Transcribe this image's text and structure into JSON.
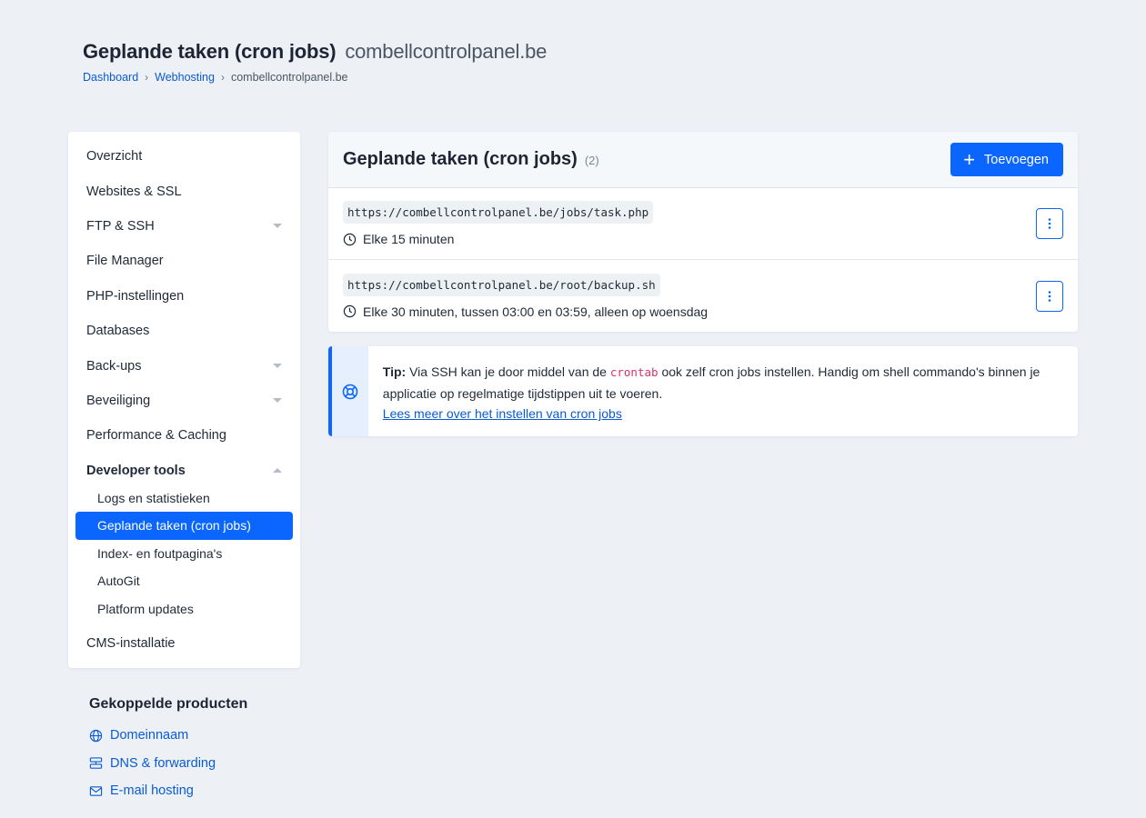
{
  "header": {
    "title": "Geplande taken (cron jobs)",
    "domain": "combellcontrolpanel.be",
    "breadcrumb": [
      "Dashboard",
      "Webhosting",
      "combellcontrolpanel.be"
    ]
  },
  "sidebar": {
    "items": [
      {
        "label": "Overzicht"
      },
      {
        "label": "Websites & SSL"
      },
      {
        "label": "FTP & SSH"
      },
      {
        "label": "File Manager"
      },
      {
        "label": "PHP-instellingen"
      },
      {
        "label": "Databases"
      },
      {
        "label": "Back-ups"
      },
      {
        "label": "Beveiliging"
      },
      {
        "label": "Performance & Caching"
      },
      {
        "label": "Developer tools"
      },
      {
        "label": "CMS-installatie"
      }
    ],
    "subitems": [
      {
        "label": "Logs en statistieken"
      },
      {
        "label": "Geplande taken (cron jobs)"
      },
      {
        "label": "Index- en foutpagina's"
      },
      {
        "label": "AutoGit"
      },
      {
        "label": "Platform updates"
      }
    ]
  },
  "linked": {
    "title": "Gekoppelde producten",
    "items": [
      {
        "label": "Domeinnaam",
        "icon": "globe-icon"
      },
      {
        "label": "DNS & forwarding",
        "icon": "server-icon"
      },
      {
        "label": "E-mail hosting",
        "icon": "mail-icon"
      }
    ]
  },
  "card": {
    "title": "Geplande taken (cron jobs)",
    "count": "(2)",
    "add_label": "Toevoegen",
    "jobs": [
      {
        "url": "https://combellcontrolpanel.be/jobs/task.php",
        "schedule": "Elke 15 minuten"
      },
      {
        "url": "https://combellcontrolpanel.be/root/backup.sh",
        "schedule": "Elke 30 minuten, tussen 03:00 en 03:59, alleen op woensdag"
      }
    ]
  },
  "tip": {
    "label": "Tip:",
    "text_before": "Via SSH kan je door middel van de",
    "code": "crontab",
    "text_after": "ook zelf cron jobs instellen. Handig om shell commando's binnen je applicatie op regelmatige tijdstippen uit te voeren.",
    "link": "Lees meer over het instellen van cron jobs"
  },
  "colors": {
    "accent": "#0a66ff",
    "background": "#edf1f6",
    "code": "#d6336c"
  }
}
